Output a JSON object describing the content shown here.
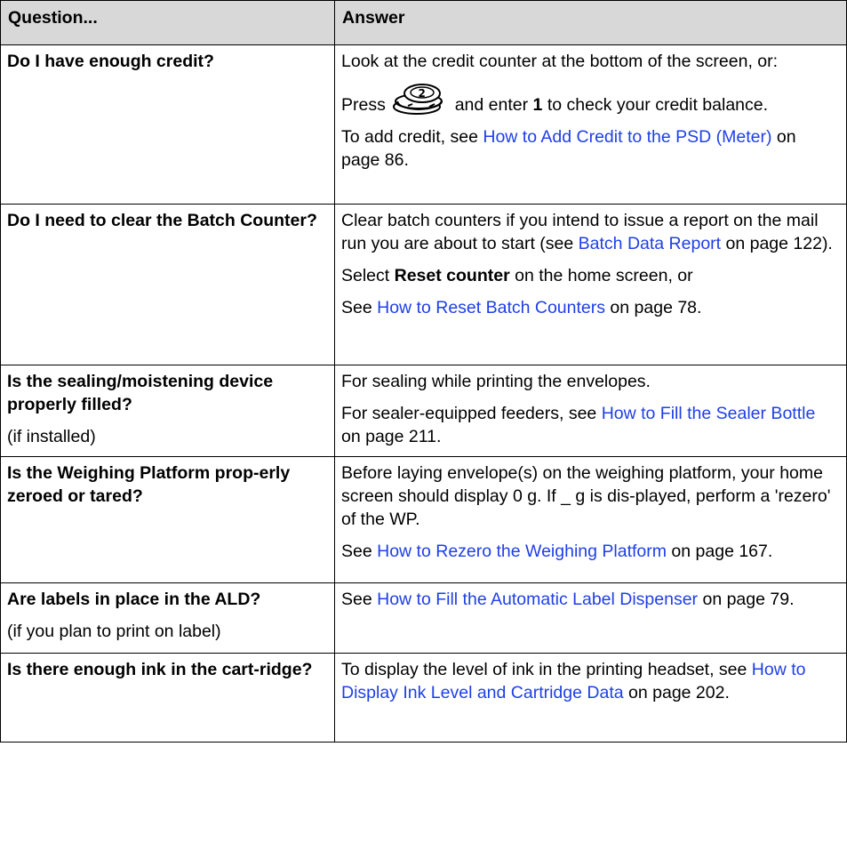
{
  "headers": {
    "question": "Question...",
    "answer": "Answer"
  },
  "rows": [
    {
      "question": "Do I have enough credit?",
      "a1": "Look at the credit counter at the bottom of the screen, or:",
      "a2_pre": "Press",
      "a2_mid": "and enter",
      "a2_key": "1",
      "a2_post": "to check your credit balance.",
      "a3_pre": "To add credit, see",
      "a3_link": "How to Add Credit to the PSD (Meter)",
      "a3_post": "on page 86."
    },
    {
      "question": "Do I need to clear the Batch Counter?",
      "a1_pre": "Clear batch counters if you intend to issue a report on the mail run you are about to start (see",
      "a1_link": "Batch Data Report",
      "a1_post": "on page 122).",
      "a2_pre": "Select",
      "a2_bold": "Reset counter",
      "a2_post": "on the home screen, or",
      "a3_pre": "See",
      "a3_link": "How to Reset Batch Counters",
      "a3_post": "on page 78."
    },
    {
      "question": "Is the sealing/moistening device properly filled?",
      "note": "(if installed)",
      "a1": "For sealing while printing the envelopes.",
      "a2_pre": "For sealer-equipped feeders, see",
      "a2_link": "How to Fill the Sealer Bottle",
      "a2_post": "on page 211."
    },
    {
      "question": "Is the Weighing Platform prop-erly zeroed or tared?",
      "a1": "Before laying envelope(s) on the weighing platform, your home screen should display 0 g. If _ g is dis-played, perform a 'rezero' of the WP.",
      "a2_pre": "See",
      "a2_link": "How to Rezero the Weighing Platform",
      "a2_post": "on page 167."
    },
    {
      "question": "Are labels in place in the ALD?",
      "note": "(if you plan to print on label)",
      "a1_pre": "See",
      "a1_link": "How to Fill the Automatic Label Dispenser",
      "a1_post": "on page 79."
    },
    {
      "question": "Is there enough ink in the cart-ridge?",
      "a1_pre": "To display the level of ink in the printing headset, see",
      "a1_link": "How to Display Ink Level and Cartridge Data",
      "a1_post": "on page 202."
    }
  ],
  "icons": {
    "credit_button": "coins-icon"
  },
  "colors": {
    "link": "#1f3fe6",
    "header_bg": "#d8d8d8"
  }
}
